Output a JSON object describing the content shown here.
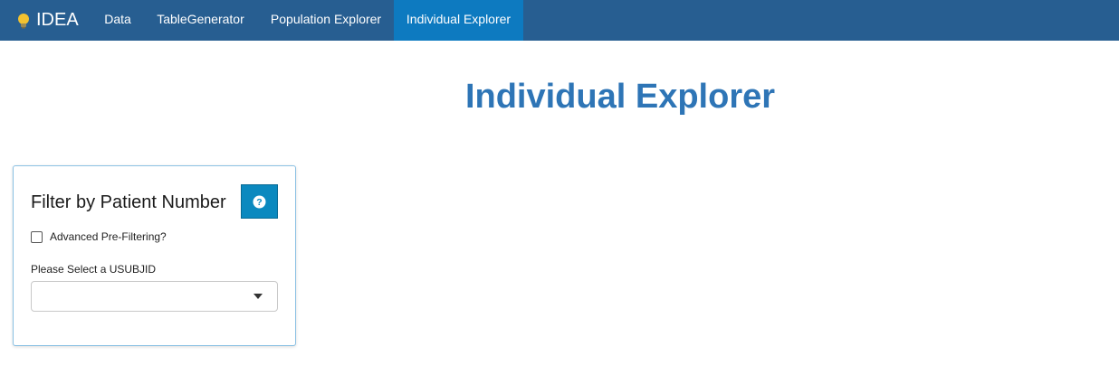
{
  "navbar": {
    "brand": "IDEA",
    "brand_icon": "lightbulb-icon",
    "items": [
      {
        "label": "Data",
        "active": false
      },
      {
        "label": "TableGenerator",
        "active": false
      },
      {
        "label": "Population Explorer",
        "active": false
      },
      {
        "label": "Individual Explorer",
        "active": true
      }
    ],
    "colors": {
      "background": "#275e91",
      "active": "#0d7ac0"
    }
  },
  "main": {
    "title": "Individual Explorer",
    "title_color": "#2e75b6"
  },
  "filter_panel": {
    "title": "Filter by Patient Number",
    "help_icon": "question-circle-icon",
    "advanced_checkbox": {
      "label": "Advanced Pre-Filtering?",
      "checked": false
    },
    "usubjid_select": {
      "label": "Please Select a USUBJID",
      "value": ""
    }
  }
}
